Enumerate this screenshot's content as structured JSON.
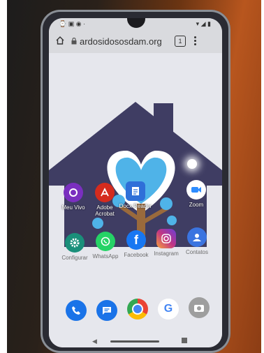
{
  "browser": {
    "url": "ardosidososdam.org",
    "tab_count": "1"
  },
  "apps_row1": [
    {
      "label": "Meu Vivo",
      "icon": "meu-vivo-icon",
      "color": "#7a2fbf"
    },
    {
      "label": "Adobe Acrobat",
      "icon": "adobe-acrobat-icon",
      "color": "#d52b1e"
    },
    {
      "label": "Docx Reader",
      "icon": "docx-reader-icon",
      "color": "#2f6fd8"
    },
    {
      "label": "Zoom",
      "icon": "zoom-icon",
      "color": "#2d8cff"
    }
  ],
  "apps_row2": [
    {
      "label": "Configurar",
      "icon": "settings-icon",
      "color": "#1a8f7a"
    },
    {
      "label": "WhatsApp",
      "icon": "whatsapp-icon",
      "color": "#25d366"
    },
    {
      "label": "Facebook",
      "icon": "facebook-icon",
      "color": "#1877f2"
    },
    {
      "label": "Instagram",
      "icon": "instagram-icon",
      "color": "#c13584"
    },
    {
      "label": "Contatos",
      "icon": "contacts-icon",
      "color": "#3b74e0"
    }
  ],
  "dock": [
    {
      "icon": "phone-icon",
      "color": "#1a73e8"
    },
    {
      "icon": "messages-icon",
      "color": "#1a73e8"
    },
    {
      "icon": "chrome-icon",
      "color": "#ea4335"
    },
    {
      "icon": "google-icon",
      "color": "#ffffff"
    },
    {
      "icon": "camera-icon",
      "color": "#9e9e9e"
    }
  ],
  "colors": {
    "house": "#3f3d63",
    "heart": "#4fb3e8",
    "tree_trunk": "#9a6a3c"
  }
}
